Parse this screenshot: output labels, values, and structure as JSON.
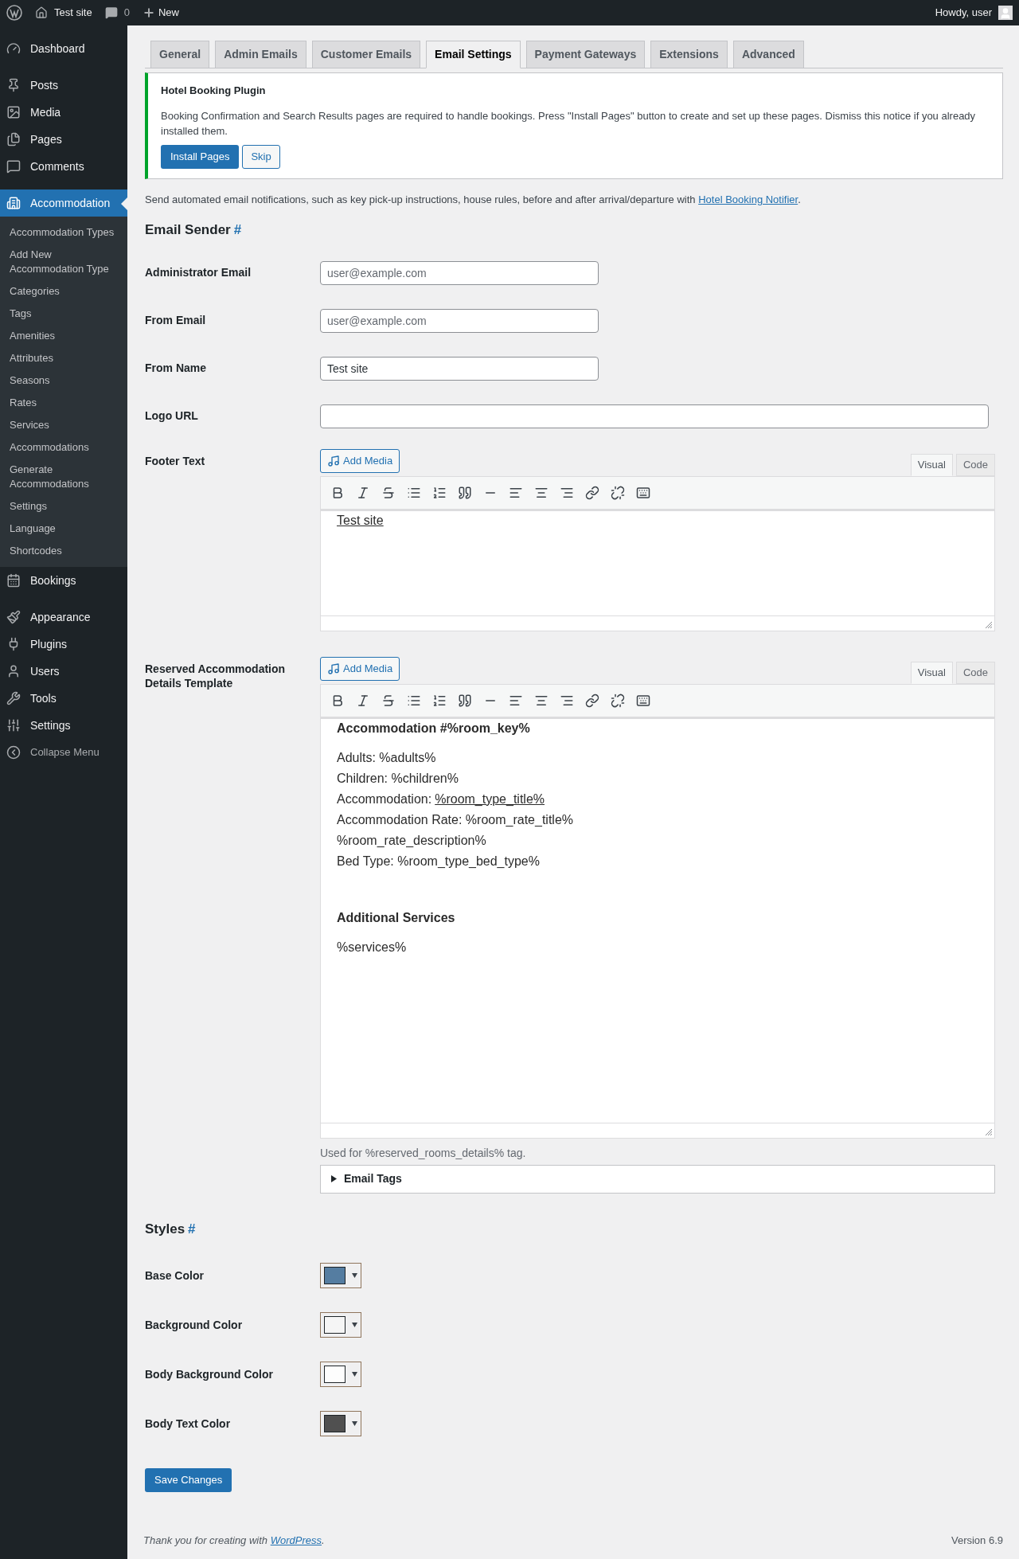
{
  "admin_bar": {
    "site": "Test site",
    "comments": "0",
    "new": "New",
    "greeting": "Howdy, user"
  },
  "sidebar": {
    "items": [
      {
        "label": "Dashboard",
        "selected": false
      },
      {
        "label": "Posts",
        "selected": false
      },
      {
        "label": "Media",
        "selected": false
      },
      {
        "label": "Pages",
        "selected": false
      },
      {
        "label": "Comments",
        "selected": false
      },
      {
        "label": "Accommodation",
        "selected": true,
        "children": [
          "Accommodation Types",
          "Add New Accommodation Type",
          "Categories",
          "Tags",
          "Amenities",
          "Attributes",
          "Seasons",
          "Rates",
          "Services",
          "Accommodations",
          "Generate Accommodations",
          "Settings",
          "Language",
          "Shortcodes"
        ]
      },
      {
        "label": "Bookings",
        "selected": false
      },
      {
        "label": "Appearance",
        "selected": false
      },
      {
        "label": "Plugins",
        "selected": false
      },
      {
        "label": "Users",
        "selected": false
      },
      {
        "label": "Tools",
        "selected": false
      },
      {
        "label": "Settings",
        "selected": false
      }
    ],
    "collapse": "Collapse Menu"
  },
  "tabs": [
    {
      "label": "General",
      "selected": false
    },
    {
      "label": "Admin Emails",
      "selected": false
    },
    {
      "label": "Customer Emails",
      "selected": false
    },
    {
      "label": "Email Settings",
      "selected": true
    },
    {
      "label": "Payment Gateways",
      "selected": false
    },
    {
      "label": "Extensions",
      "selected": false
    },
    {
      "label": "Advanced",
      "selected": false
    }
  ],
  "notice": {
    "title": "Hotel Booking Plugin",
    "text": "Booking Confirmation and Search Results pages are required to handle bookings. Press \"Install Pages\" button to create and set up these pages. Dismiss this notice if you already installed them.",
    "primary": "Install Pages",
    "secondary": "Skip"
  },
  "intro": {
    "text": "Send automated email notifications, such as key pick-up instructions, house rules, before and after arrival/departure with",
    "link": "Hotel Booking Notifier",
    "end": "."
  },
  "email_sender": {
    "heading": "Email Sender",
    "anchor": "#",
    "fields": [
      {
        "label": "Administrator Email",
        "placeholder": "user@example.com"
      },
      {
        "label": "From Email",
        "placeholder": "user@example.com"
      },
      {
        "label": "From Name",
        "value": "Test site"
      },
      {
        "label": "Logo URL"
      }
    ]
  },
  "editors": [
    {
      "label": "Footer Text",
      "add_media": "Add Media",
      "tabs": [
        {
          "label": "Visual",
          "selected": true
        },
        {
          "label": "Code",
          "selected": false
        }
      ],
      "blocks": [
        {
          "kind": "link",
          "text": "Test site"
        }
      ]
    },
    {
      "label": "Reserved Accommodation Details Template",
      "add_media": "Add Media",
      "tabs": [
        {
          "label": "Visual",
          "selected": true
        },
        {
          "label": "Code",
          "selected": false
        }
      ],
      "note": "Used for %reserved_rooms_details% tag.",
      "blocks": [
        {
          "kind": "heading",
          "text": "Accommodation #%room_key%"
        },
        {
          "kind": "line",
          "text": "Adults: %adults%"
        },
        {
          "kind": "line",
          "text": "Children: %children%"
        },
        {
          "kind": "line",
          "text": "Accommodation:",
          "link": "%room_type_title%"
        },
        {
          "kind": "line",
          "text": "Accommodation Rate: %room_rate_title%"
        },
        {
          "kind": "line",
          "text": "%room_rate_description%"
        },
        {
          "kind": "line",
          "text": "Bed Type: %room_type_bed_type%"
        },
        {
          "kind": "heading",
          "text": "Additional Services"
        },
        {
          "kind": "line",
          "text": "%services%"
        }
      ],
      "tags": {
        "label": "Email Tags",
        "expanded": false
      }
    }
  ],
  "styles": {
    "heading": "Styles",
    "anchor": "#",
    "colors": [
      {
        "label": "Base Color",
        "color": "#557da1"
      },
      {
        "label": "Background Color",
        "color": "#f5f5f5"
      },
      {
        "label": "Body Background Color",
        "color": "#fdfdfd"
      },
      {
        "label": "Body Text Color",
        "color": "#505050"
      }
    ]
  },
  "save": "Save Changes",
  "footer": {
    "text": "Thank you for creating with",
    "link": "WordPress",
    "end": ".",
    "version": "Version 6.9"
  }
}
